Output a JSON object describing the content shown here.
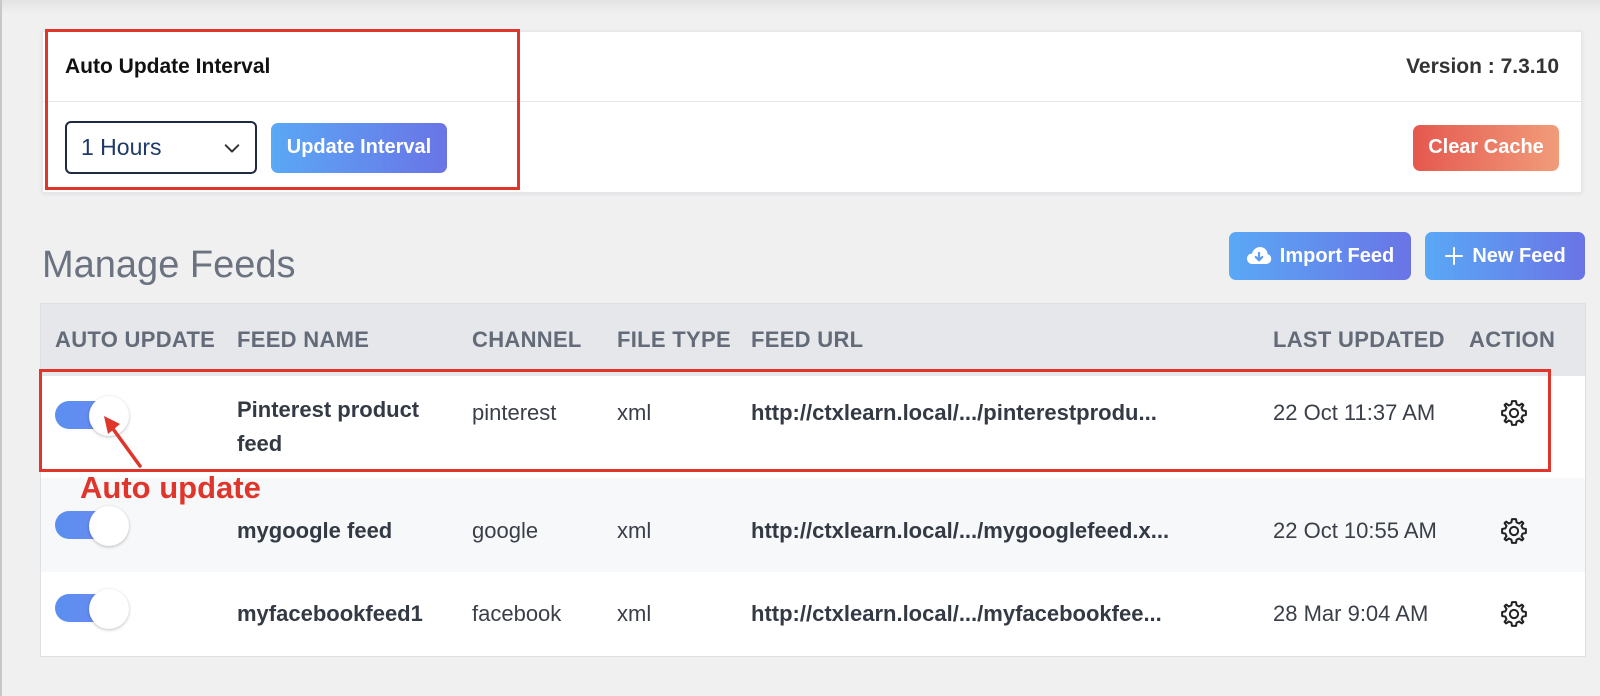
{
  "settings": {
    "title": "Auto Update Interval",
    "version": "Version : 7.3.10",
    "interval_selected": "1 Hours",
    "update_button": "Update Interval",
    "clear_cache_button": "Clear Cache"
  },
  "manage": {
    "title": "Manage Feeds",
    "import_button": "Import Feed",
    "new_button": "New Feed"
  },
  "table": {
    "headers": [
      "AUTO UPDATE",
      "FEED NAME",
      "CHANNEL",
      "FILE TYPE",
      "FEED URL",
      "LAST UPDATED",
      "ACTION"
    ],
    "rows": [
      {
        "auto_update": true,
        "name": "Pinterest product feed",
        "channel": "pinterest",
        "file_type": "xml",
        "url": "http://ctxlearn.local/.../pinterestprodu...",
        "updated": "22 Oct 11:37 AM",
        "action_icon": "gear-icon"
      },
      {
        "auto_update": true,
        "name": "mygoogle feed",
        "channel": "google",
        "file_type": "xml",
        "url": "http://ctxlearn.local/.../mygooglefeed.x...",
        "updated": "22 Oct 10:55 AM",
        "action_icon": "gear-icon"
      },
      {
        "auto_update": true,
        "name": "myfacebookfeed1",
        "channel": "facebook",
        "file_type": "xml",
        "url": "http://ctxlearn.local/.../myfacebookfee...",
        "updated": "28 Mar 9:04 AM",
        "action_icon": "gear-icon"
      }
    ]
  },
  "annotation": {
    "label": "Auto update",
    "color": "#e0352b"
  },
  "colors": {
    "accent_blue": "#5aa8f6",
    "accent_purple": "#6a74e6",
    "danger": "#e5584f"
  }
}
